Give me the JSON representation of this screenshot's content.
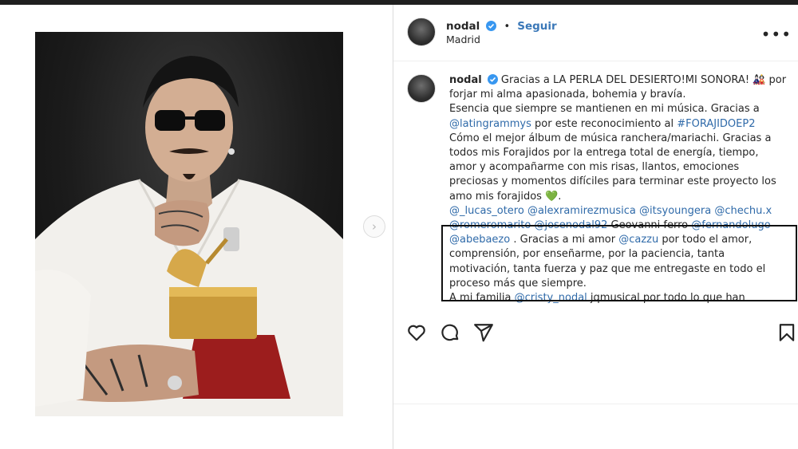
{
  "post": {
    "username": "nodal",
    "follow_label": "Seguir",
    "location": "Madrid",
    "more_label": "•••",
    "next_arrow": "›"
  },
  "caption": {
    "username": "nodal",
    "text_1": "Gracias a LA PERLA DEL DESIERTO!MI SONORA! ",
    "emoji_1": "🎎",
    "text_2": " por forjar mi alma apasionada, bohemia y bravía.",
    "line_2": "Esencia que siempre se mantienen en mi música. Gracias a ",
    "mention_latingrammys": "@latingrammys",
    "text_3": " por este reconocimiento al ",
    "hashtag": "#FORAJIDOEP2",
    "text_4": "Cómo el mejor álbum de música ranchera/mariachi. Gracias a todos mis Forajidos por la entrega total de energía, tiempo, amor y acompañarme con mis risas, llantos, emociones preciosas y momentos difíciles para terminar este proyecto los amo mis forajidos ",
    "emoji_heart": "💚",
    "text_5": ".",
    "m1": "@_lucas_otero",
    "m2": "@alexramirezmusica",
    "m3": "@itsyoungera",
    "m4": "@chechu.x",
    "m5": "@romeromarito",
    "m6": "@josenodal92",
    "text_6": " Geovanni ferro ",
    "m7": "@fernandolugo",
    "m8": "@abebaezo",
    "text_7": " . Gracias a mi amor ",
    "m9": "@cazzu",
    "text_8": " por todo el amor, comprensión, por enseñarme, por la paciencia, tanta motivación, tanta fuerza y paz que me entregaste en todo el proceso más que siempre.",
    "text_9": "A mi familia ",
    "m10": "@cristy_nodal",
    "text_10": " jqmusical por todo lo que han"
  },
  "colors": {
    "link": "#2f6aa9",
    "verified": "#3897f0",
    "follow": "#3b78b8",
    "heart": "#2ecc71"
  },
  "icons": [
    "heart-icon",
    "comment-icon",
    "share-icon",
    "bookmark-icon",
    "verified-icon",
    "more-icon"
  ]
}
